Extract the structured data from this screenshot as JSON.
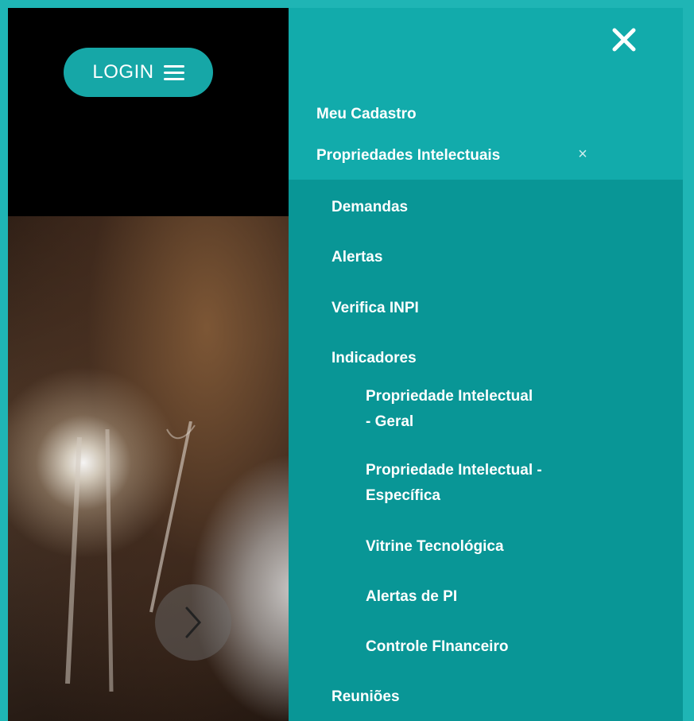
{
  "header": {
    "login_label": "LOGIN",
    "menu_icon": "hamburger-icon"
  },
  "hero": {
    "next_icon": "chevron-right-icon"
  },
  "menu": {
    "close_icon": "close-icon",
    "submenu_close_glyph": "×",
    "items": [
      {
        "label": "Meu Cadastro"
      },
      {
        "label": "Propriedades Intelectuais"
      }
    ],
    "sub_items": [
      {
        "label": "Demandas"
      },
      {
        "label": "Alertas"
      },
      {
        "label": "Verifica INPI"
      },
      {
        "label": "Indicadores"
      },
      {
        "label": "Reuniões"
      }
    ],
    "indicadores_items": [
      {
        "line1": "Propriedade Intelectual",
        "line2": "- Geral"
      },
      {
        "line1": "Propriedade Intelectual -",
        "line2": "Específica"
      },
      {
        "label": "Vitrine Tecnológica"
      },
      {
        "label": "Alertas de PI"
      },
      {
        "label": "Controle FInanceiro"
      }
    ]
  },
  "colors": {
    "accent": "#16a7a7",
    "menu_top": "#12abab",
    "menu_bg": "#099696",
    "border": "#1fb5b5"
  }
}
